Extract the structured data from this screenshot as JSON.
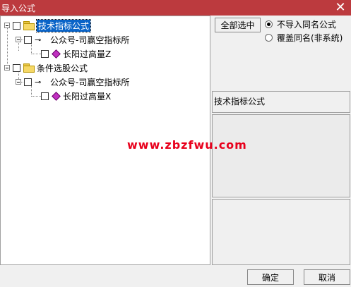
{
  "window": {
    "title": "导入公式",
    "close_glyph": "✕"
  },
  "tree": {
    "groups": [
      {
        "label": "技术指标公式",
        "child": "公众号-司赢空指标所",
        "leaf": "长阳过高量Z"
      },
      {
        "label": "条件选股公式",
        "child": "公众号-司赢空指标所",
        "leaf": "长阳过高量X"
      }
    ]
  },
  "options": {
    "select_all_label": "全部选中",
    "radio_no_import": "不导入同名公式",
    "radio_overwrite": "覆盖同名(非系统)",
    "selected": "radio_no_import"
  },
  "info": {
    "type_label": "技术指标公式"
  },
  "watermark": "www.zbzfwu.com",
  "footer": {
    "ok_label": "确定",
    "cancel_label": "取消"
  }
}
